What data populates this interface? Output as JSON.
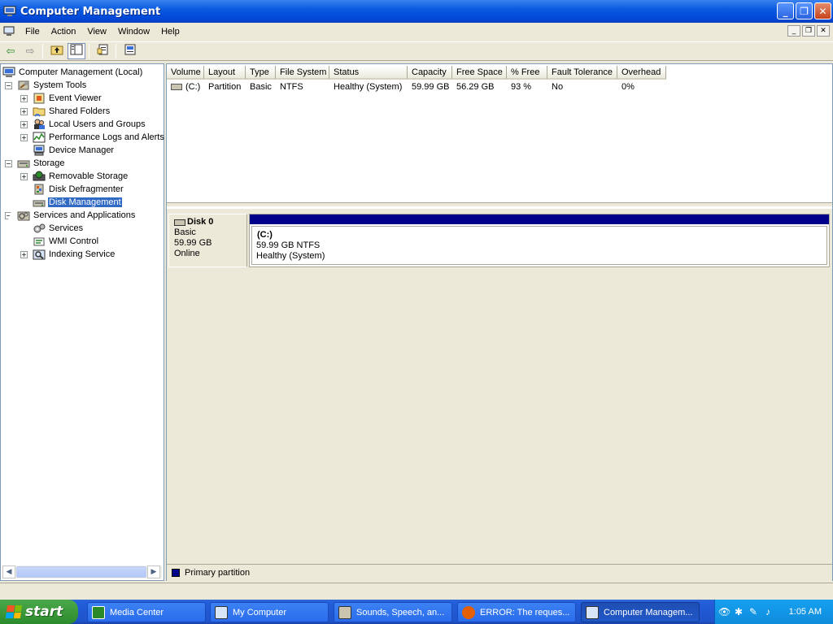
{
  "window": {
    "title": "Computer Management"
  },
  "menu": [
    "File",
    "Action",
    "View",
    "Window",
    "Help"
  ],
  "tree": {
    "root": "Computer Management (Local)",
    "system_tools": "System Tools",
    "event_viewer": "Event Viewer",
    "shared_folders": "Shared Folders",
    "local_users": "Local Users and Groups",
    "perf_logs": "Performance Logs and Alerts",
    "device_manager": "Device Manager",
    "storage": "Storage",
    "removable_storage": "Removable Storage",
    "disk_defrag": "Disk Defragmenter",
    "disk_management": "Disk Management",
    "services_apps": "Services and Applications",
    "services": "Services",
    "wmi": "WMI Control",
    "indexing": "Indexing Service"
  },
  "volume_list": {
    "columns": [
      "Volume",
      "Layout",
      "Type",
      "File System",
      "Status",
      "Capacity",
      "Free Space",
      "% Free",
      "Fault Tolerance",
      "Overhead"
    ],
    "rows": [
      [
        "(C:)",
        "Partition",
        "Basic",
        "NTFS",
        "Healthy (System)",
        "59.99 GB",
        "56.29 GB",
        "93 %",
        "No",
        "0%"
      ]
    ]
  },
  "disk": {
    "name": "Disk 0",
    "type": "Basic",
    "size": "59.99 GB",
    "status": "Online",
    "partition": {
      "label": "(C:)",
      "detail": "59.99 GB NTFS",
      "status": "Healthy (System)"
    }
  },
  "legend": {
    "primary": "Primary partition"
  },
  "taskbar": {
    "start": "start",
    "tasks": [
      "Media Center",
      "My Computer",
      "Sounds, Speech, an...",
      "ERROR: The reques...",
      "Computer Managem..."
    ],
    "clock": "1:05 AM"
  },
  "colors": {
    "partition": "#00008b",
    "selection": "#316ac5",
    "titlebar": "#0a5be0"
  }
}
